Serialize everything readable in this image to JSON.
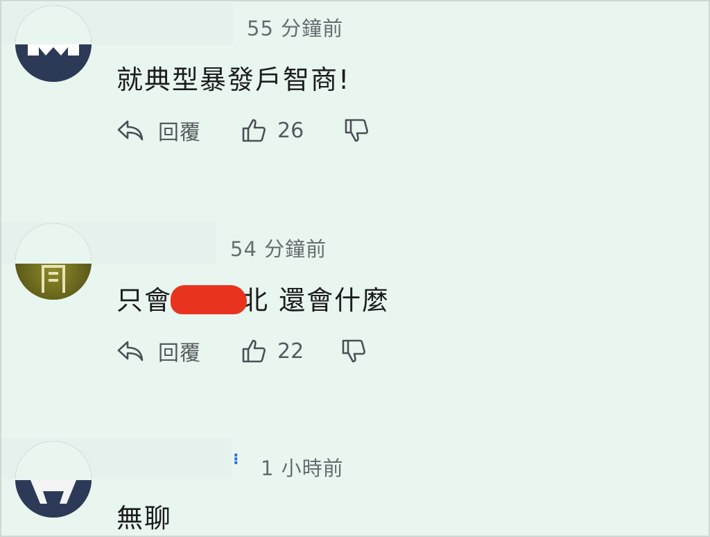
{
  "comments": [
    {
      "timestamp": "55 分鐘前",
      "text": "就典型暴發戶智商!",
      "reply_label": "回覆",
      "likes": "26"
    },
    {
      "timestamp": "54 分鐘前",
      "text_before": "只會",
      "text_after": "北 還會什麼",
      "reply_label": "回覆",
      "likes": "22"
    },
    {
      "timestamp": "1 小時前",
      "text": "無聊"
    }
  ],
  "colors": {
    "background": "#e9f6f0",
    "redaction": "#e8341f",
    "avatar_navy": "#2d3a57",
    "avatar_olive": "#6b6a20"
  },
  "icons": [
    "reply-icon",
    "thumbs-up-icon",
    "thumbs-down-icon"
  ]
}
